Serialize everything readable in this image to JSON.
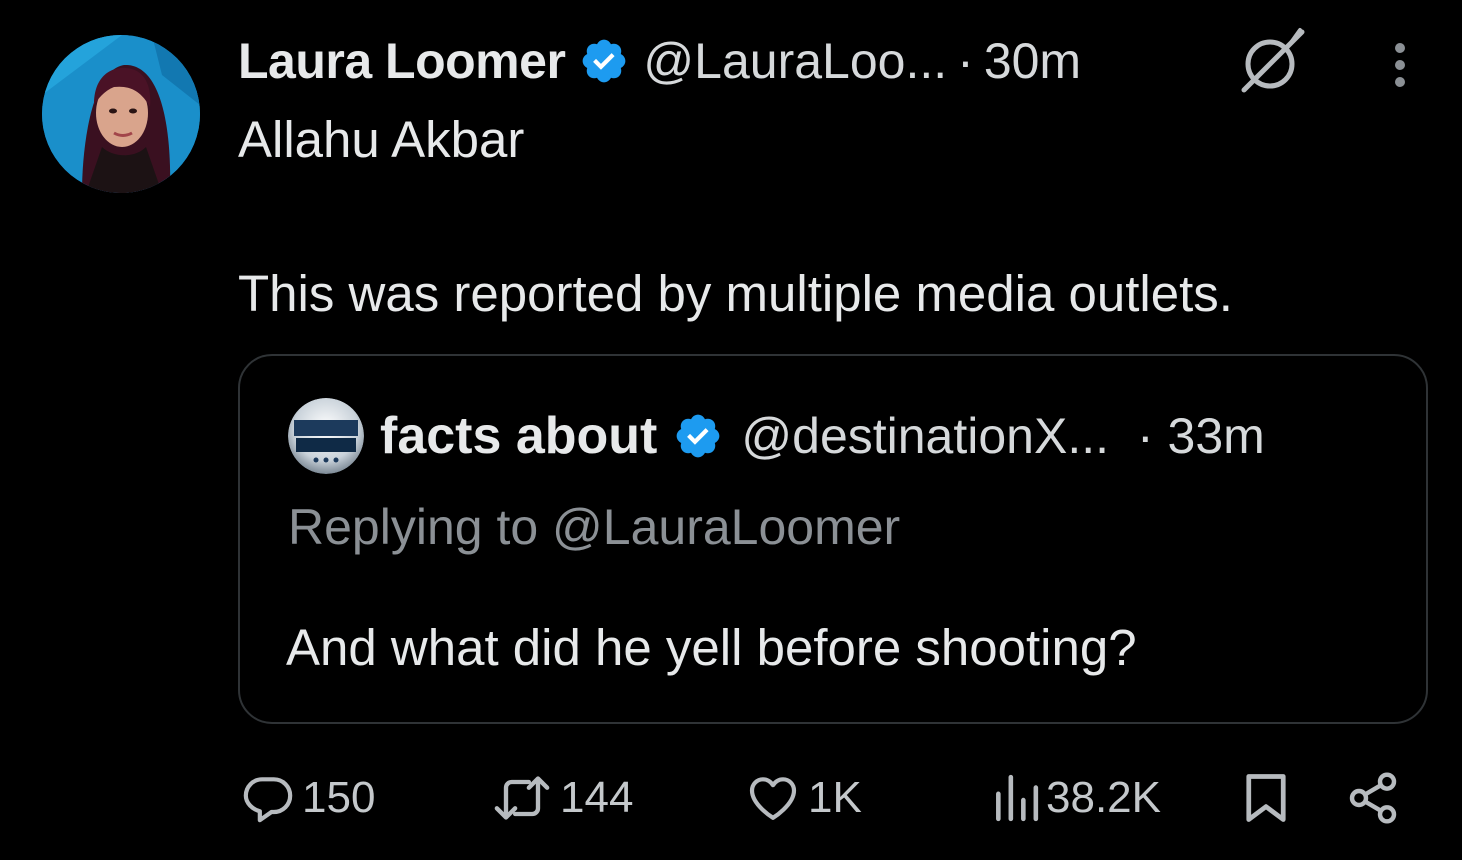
{
  "post": {
    "author": {
      "display_name": "Laura Loomer",
      "handle": "@LauraLoo...",
      "verified": true,
      "avatar": "avatar-woman-dark-hair"
    },
    "separator": "·",
    "time": "30m",
    "grok_icon": "grok-icon",
    "more_icon": "more-dots-icon",
    "text_lines": [
      "Allahu Akbar",
      "This was reported by multiple media outlets."
    ]
  },
  "quote": {
    "author": {
      "display_name": "facts about",
      "handle": "@destinationX...",
      "verified": true,
      "avatar": "facts-about-logo"
    },
    "time": "· 33m",
    "replying_to": "Replying to @LauraLoomer",
    "text": "And what did he yell before shooting?"
  },
  "actions": {
    "replies": "150",
    "reposts": "144",
    "likes": "1K",
    "views": "38.2K",
    "bookmark_icon": "bookmark-icon",
    "share_icon": "share-icon"
  },
  "colors": {
    "background": "#000000",
    "text_primary": "#e7e9ea",
    "text_secondary": "#8b9095",
    "verified_blue": "#1d9bf0",
    "border": "#2f3336"
  }
}
